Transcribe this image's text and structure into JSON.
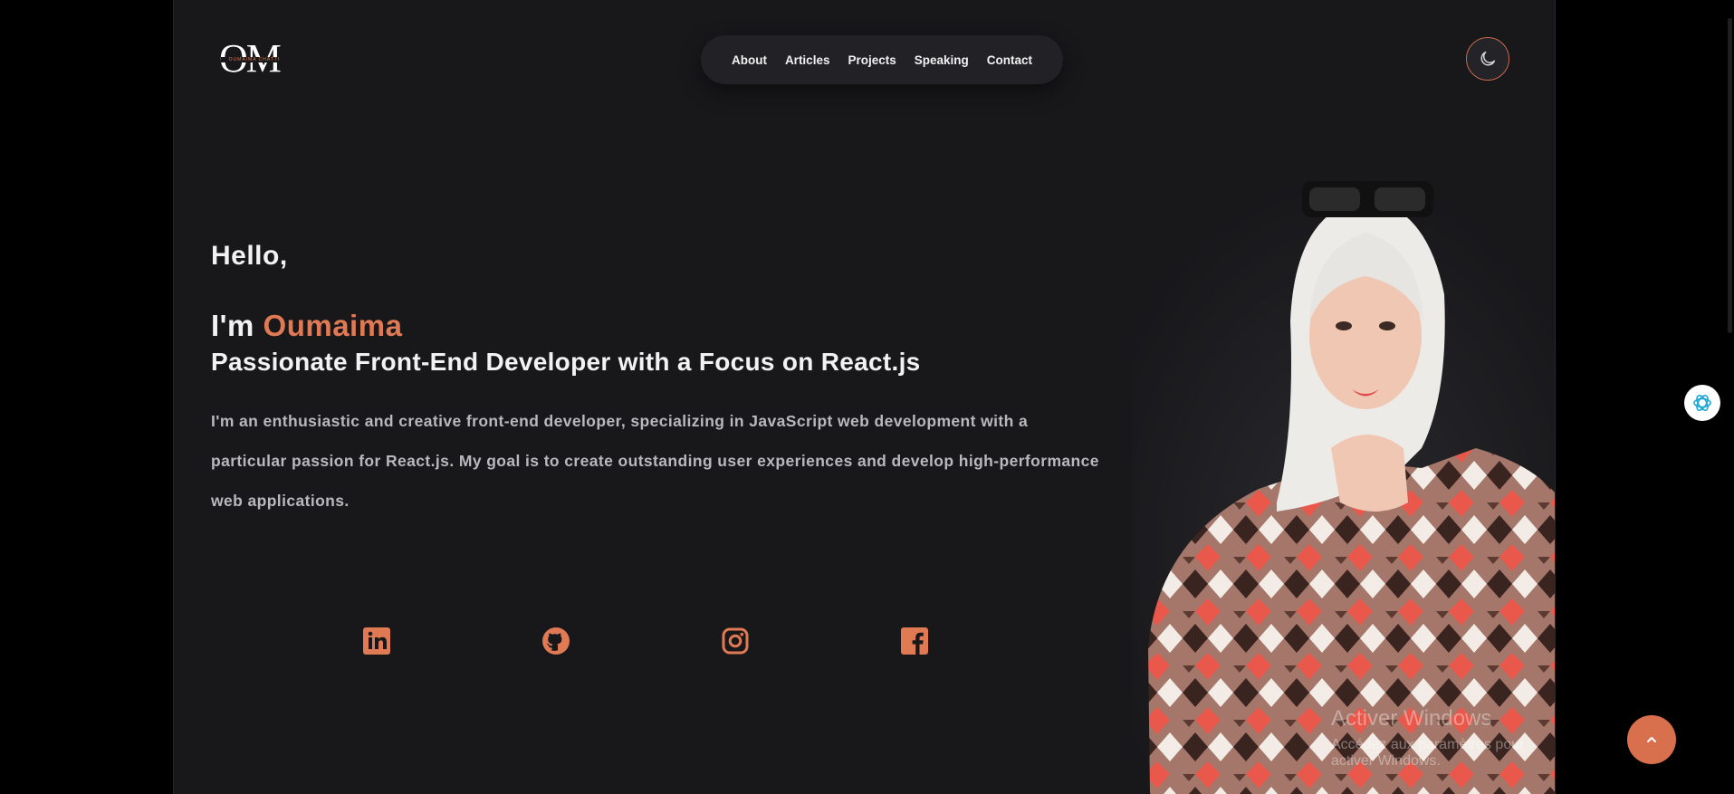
{
  "header": {
    "logo_text": "OM",
    "logo_subtext": "OUMAIMA CHATTI",
    "nav": [
      {
        "label": "About"
      },
      {
        "label": "Articles"
      },
      {
        "label": "Projects"
      },
      {
        "label": "Speaking"
      },
      {
        "label": "Contact"
      }
    ],
    "theme_toggle_icon": "moon-icon"
  },
  "hero": {
    "greeting": "Hello,",
    "intro_prefix": "I'm ",
    "name": "Oumaima",
    "role": "Passionate Front-End Developer with a Focus on React.js",
    "bio": "I'm an enthusiastic and creative front-end developer, specializing in JavaScript web development with a particular passion for React.js. My goal is to create outstanding user experiences and develop high-performance web applications."
  },
  "socials": [
    {
      "icon": "linkedin-icon"
    },
    {
      "icon": "github-icon"
    },
    {
      "icon": "instagram-icon"
    },
    {
      "icon": "facebook-icon"
    }
  ],
  "overlay": {
    "activation_title": "Activer Windows",
    "activation_subtitle": "Accédez aux paramètres pour activer Windows."
  },
  "floating": {
    "ai_icon": "openai-icon",
    "scroll_top_icon": "chevron-up-icon"
  },
  "colors": {
    "accent": "#e07a54",
    "page_bg": "#18181b",
    "outer_bg": "#000000",
    "nav_bg": "#212126",
    "text": "#f2f2f2",
    "muted_text": "#b8b8bd"
  }
}
